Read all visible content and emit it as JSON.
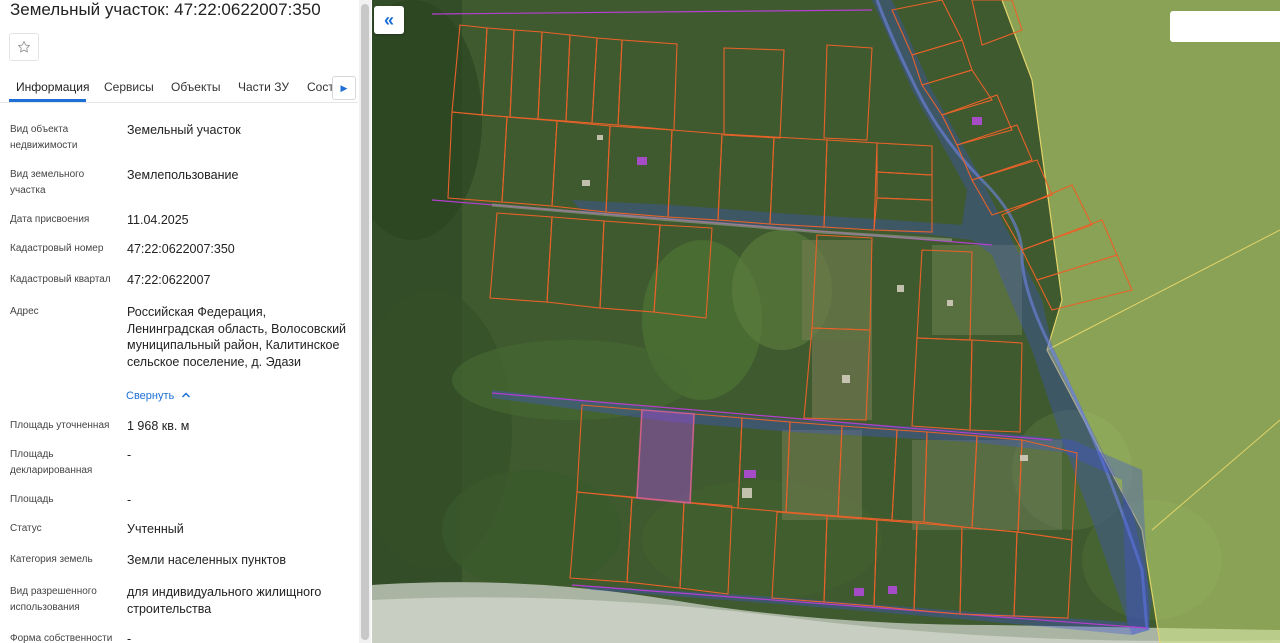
{
  "panel": {
    "title": "Земельный участок: 47:22:0622007:350",
    "tabs": [
      "Информация",
      "Сервисы",
      "Объекты",
      "Части ЗУ",
      "Соста"
    ],
    "active_tab": "Информация",
    "fields": [
      {
        "label": "Вид объекта недвижимости",
        "value": "Земельный участок"
      },
      {
        "label": "Вид земельного участка",
        "value": "Землепользование"
      },
      {
        "label": "Дата присвоения",
        "value": "11.04.2025"
      },
      {
        "label": "Кадастровый номер",
        "value": "47:22:0622007:350"
      },
      {
        "label": "Кадастровый квартал",
        "value": "47:22:0622007"
      },
      {
        "label": "Адрес",
        "value": "Российская Федерация, Ленинградская область, Волосовский муниципальный район, Калитинское сельское поселение, д. Эдази"
      },
      {
        "label": "Площадь уточненная",
        "value": "1 968 кв. м"
      },
      {
        "label": "Площадь декларированная",
        "value": "-"
      },
      {
        "label": "Площадь",
        "value": "-"
      },
      {
        "label": "Статус",
        "value": "Учтенный"
      },
      {
        "label": "Категория земель",
        "value": "Земли населенных пунктов"
      },
      {
        "label": "Вид разрешенного использования",
        "value": "для индивидуального жилищного строительства"
      },
      {
        "label": "Форма собственности",
        "value": "-"
      }
    ],
    "collapse_link": "Свернуть"
  },
  "map": {
    "icons": [
      "star-icon",
      "chevron-right-icon",
      "double-chevron-left-icon",
      "chevron-up-icon"
    ],
    "colors": {
      "parcel_border": "#e8622a",
      "selected_parcel": "#a64bd6",
      "protection_zone": "#3f52d9",
      "forest_zone": "#c9e27a",
      "accent": "#1d6fd6"
    }
  }
}
